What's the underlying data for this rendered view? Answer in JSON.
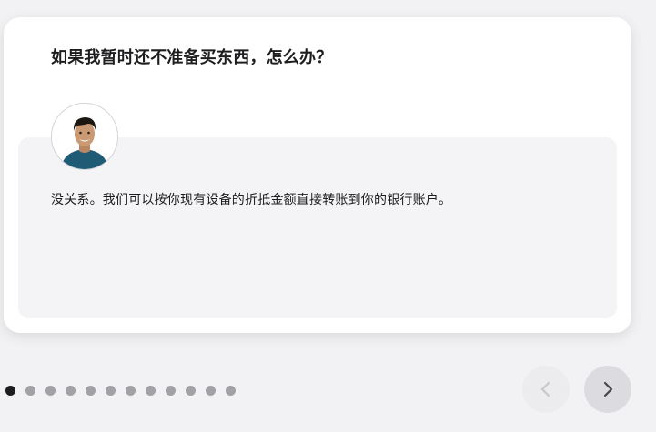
{
  "faq": {
    "question": "如果我暂时还不准备买东西，怎么办？",
    "answer": "没关系。我们可以按你现有设备的折抵金额直接转账到你的银行账户。"
  },
  "avatar": {
    "icon": "specialist-avatar",
    "colors": {
      "skin": "#c99a73",
      "hair": "#1d1712",
      "shirt": "#1f5b74"
    }
  },
  "pagination": {
    "total": 12,
    "active_index": 0,
    "colors": {
      "active": "#1d1d1f",
      "inactive": "#a1a1a6"
    }
  },
  "nav": {
    "prev_icon": "chevron-left-icon",
    "next_icon": "chevron-right-icon",
    "prev_enabled": false,
    "next_enabled": true
  }
}
